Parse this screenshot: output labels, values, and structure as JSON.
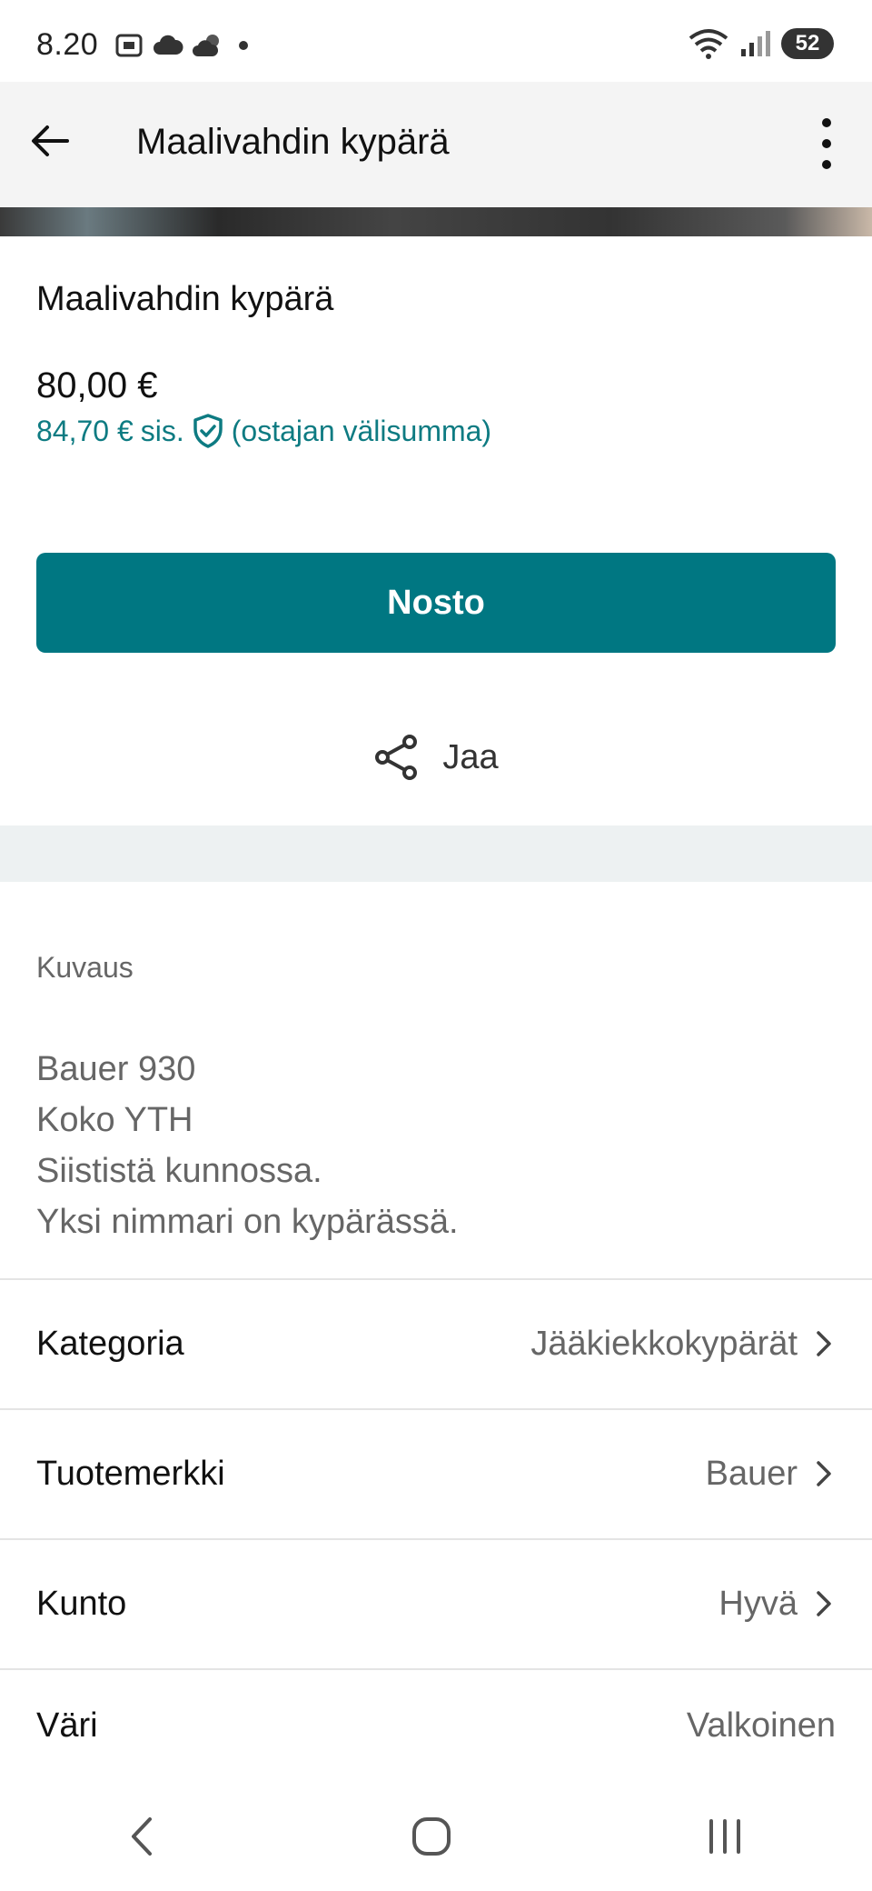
{
  "status_bar": {
    "time": "8.20",
    "battery": "52",
    "icons_left": [
      "screenshot-icon",
      "cloud-icon",
      "weather-icon",
      "dot-icon"
    ],
    "icons_right": [
      "wifi-icon",
      "signal-icon",
      "battery-icon"
    ]
  },
  "app_bar": {
    "title": "Maalivahdin kypärä",
    "back_icon": "arrow-left-icon",
    "menu_icon": "more-vert-icon"
  },
  "item": {
    "title": "Maalivahdin kypärä",
    "price": "80,00 €",
    "price_incl_amount": "84,70 €",
    "price_incl_text": "sis.",
    "price_incl_note": "(ostajan välisumma)",
    "protection_icon": "shield-check-icon"
  },
  "actions": {
    "primary_label": "Nosto",
    "share_label": "Jaa",
    "share_icon": "share-icon"
  },
  "description": {
    "label": "Kuvaus",
    "lines": [
      "Bauer 930",
      "Koko YTH",
      "Siististä kunnossa.",
      "Yksi nimmari on kypärässä."
    ]
  },
  "attributes": [
    {
      "label": "Kategoria",
      "value": "Jääkiekkokypärät"
    },
    {
      "label": "Tuotemerkki",
      "value": "Bauer"
    },
    {
      "label": "Kunto",
      "value": "Hyvä"
    },
    {
      "label": "Väri",
      "value": "Valkoinen"
    }
  ],
  "colors": {
    "accent": "#007782",
    "accent_text": "#0e7b82",
    "section_gap": "#edf1f2"
  }
}
